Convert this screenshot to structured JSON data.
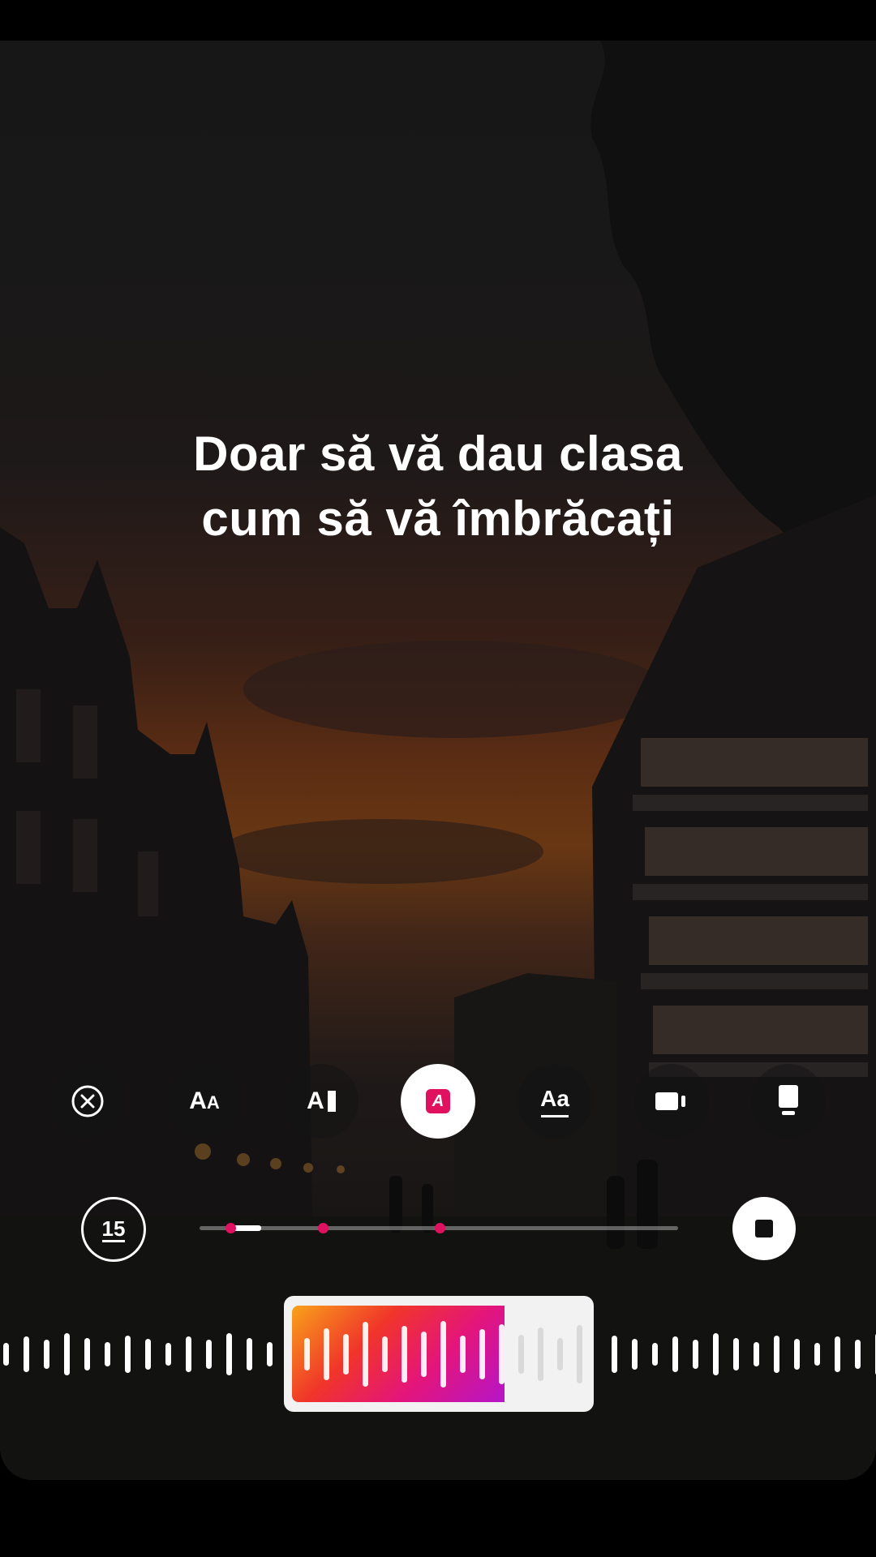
{
  "lyrics": {
    "line1": "Doar să vă dau clasa",
    "line2": "cum să vă îmbrăcați"
  },
  "style_options": [
    {
      "name": "close",
      "icon": "close-circle-icon"
    },
    {
      "name": "typewriter",
      "glyph": "AA"
    },
    {
      "name": "cursor",
      "glyph": "AI"
    },
    {
      "name": "highlight",
      "glyph": "A",
      "selected": true
    },
    {
      "name": "underline",
      "glyph": "Aa"
    },
    {
      "name": "layout-side",
      "icon": "layout-side-icon"
    },
    {
      "name": "layout-bottom",
      "icon": "layout-bottom-icon"
    }
  ],
  "timer": {
    "value": "15"
  },
  "playback": {
    "progress_fraction": 0.13,
    "markers": [
      0.06,
      0.25,
      0.42
    ]
  },
  "colors": {
    "accent": "#e0115f",
    "gradient_start": "#f9a21a",
    "gradient_end": "#b515c9"
  }
}
